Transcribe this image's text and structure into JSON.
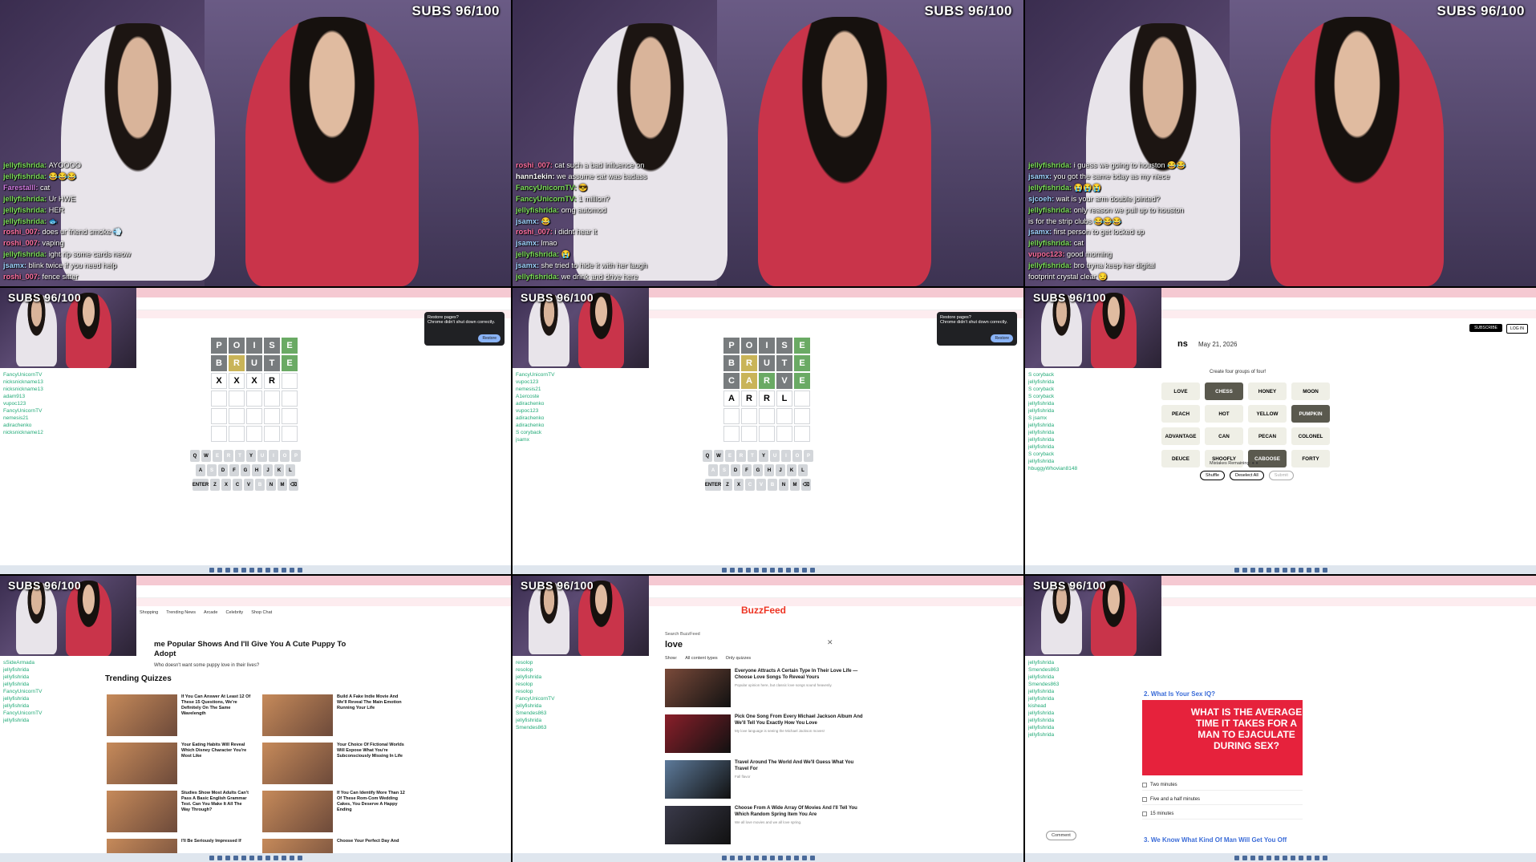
{
  "subs_badge": "SUBS 96/100",
  "stream1": {
    "chat": [
      {
        "user": "jellyfishrida",
        "color": "#7ddf5a",
        "msg": "AYOOOO"
      },
      {
        "user": "jellyfishrida",
        "color": "#7ddf5a",
        "msg": "😂😂😂"
      },
      {
        "user": "Farestalll",
        "color": "#d07ae0",
        "msg": "cat"
      },
      {
        "user": "jellyfishrida",
        "color": "#7ddf5a",
        "msg": "Ur HWE"
      },
      {
        "user": "jellyfishrida",
        "color": "#7ddf5a",
        "msg": "HER"
      },
      {
        "user": "jellyfishrida",
        "color": "#7ddf5a",
        "msg": "🐟"
      },
      {
        "user": "roshi_007",
        "color": "#ff6fa0",
        "msg": "does ur friend smoke 💨"
      },
      {
        "user": "roshi_007",
        "color": "#ff6fa0",
        "msg": "vaping"
      },
      {
        "user": "jellyfishrida",
        "color": "#7ddf5a",
        "msg": "ight rip some cards neow"
      },
      {
        "user": "jsamx",
        "color": "#9fd4ff",
        "msg": "blink twice if you need help"
      },
      {
        "user": "roshi_007",
        "color": "#ff6fa0",
        "msg": "fence sitter"
      }
    ]
  },
  "stream2": {
    "chat": [
      {
        "user": "roshi_007",
        "color": "#ff6fa0",
        "msg": "cat such a bad influence on"
      },
      {
        "user": "hann1ekin",
        "color": "#ffffff",
        "msg": "we assume cat was badass"
      },
      {
        "user": "FancyUnicornTV",
        "color": "#7ddf5a",
        "msg": "😎"
      },
      {
        "user": "FancyUnicornTV",
        "color": "#7ddf5a",
        "msg": "1 million?"
      },
      {
        "user": "jellyfishrida",
        "color": "#7ddf5a",
        "msg": "omg automod"
      },
      {
        "user": "jsamx",
        "color": "#9fd4ff",
        "msg": "😂"
      },
      {
        "user": "roshi_007",
        "color": "#ff6fa0",
        "msg": "i didnt hear it"
      },
      {
        "user": "jsamx",
        "color": "#9fd4ff",
        "msg": "lmao"
      },
      {
        "user": "jellyfishrida",
        "color": "#7ddf5a",
        "msg": "😭"
      },
      {
        "user": "jsamx",
        "color": "#9fd4ff",
        "msg": "she tried to hide it with her laugh"
      },
      {
        "user": "jellyfishrida",
        "color": "#7ddf5a",
        "msg": "we drink and drive here"
      }
    ]
  },
  "stream3": {
    "chat": [
      {
        "user": "jellyfishrida",
        "color": "#7ddf5a",
        "msg": "i guess we going to houston 😂😂"
      },
      {
        "user": "jsamx",
        "color": "#9fd4ff",
        "msg": "you got the same bday as my niece"
      },
      {
        "user": "jellyfishrida",
        "color": "#7ddf5a",
        "msg": "😭😭😭"
      },
      {
        "user": "sjcoeh",
        "color": "#9fd4ff",
        "msg": "wait is your arm double jointed?"
      },
      {
        "user": "jellyfishrida",
        "color": "#7ddf5a",
        "msg": "only reason we pull up to houston"
      },
      {
        "user": "",
        "color": "#ffffff",
        "msg": "is for the strip clubs 😂😂😂"
      },
      {
        "user": "jsamx",
        "color": "#9fd4ff",
        "msg": "first person to get locked up"
      },
      {
        "user": "jellyfishrida",
        "color": "#7ddf5a",
        "msg": "cat"
      },
      {
        "user": "vupoc123",
        "color": "#ff6fa0",
        "msg": "good morning"
      },
      {
        "user": "jellyfishrida",
        "color": "#7ddf5a",
        "msg": "bro tryna keep her digital"
      },
      {
        "user": "",
        "color": "#ffffff",
        "msg": "footprint crystal clear 😏"
      }
    ]
  },
  "wordle1": {
    "rows": [
      [
        {
          "l": "P",
          "s": "x"
        },
        {
          "l": "O",
          "s": "x"
        },
        {
          "l": "I",
          "s": "x"
        },
        {
          "l": "S",
          "s": "x"
        },
        {
          "l": "E",
          "s": "g"
        }
      ],
      [
        {
          "l": "B",
          "s": "x"
        },
        {
          "l": "R",
          "s": "y"
        },
        {
          "l": "U",
          "s": "x"
        },
        {
          "l": "T",
          "s": "x"
        },
        {
          "l": "E",
          "s": "g"
        }
      ],
      [
        {
          "l": "X",
          "s": "e"
        },
        {
          "l": "X",
          "s": "e"
        },
        {
          "l": "X",
          "s": "e"
        },
        {
          "l": "R",
          "s": "e"
        },
        {
          "l": "",
          "s": "e"
        }
      ]
    ],
    "popup_title": "Restore pages?",
    "popup_body": "Chrome didn't shut down correctly.",
    "popup_btn": "Restore",
    "chat": [
      "FancyUnicornTV",
      "nicksnickname13",
      "nicksnickname13",
      "adam913",
      "vupoc123",
      "FancyUnicornTV",
      "nemesis21",
      "adirachenko",
      "nicksnickname12"
    ]
  },
  "wordle2": {
    "rows": [
      [
        {
          "l": "P",
          "s": "x"
        },
        {
          "l": "O",
          "s": "x"
        },
        {
          "l": "I",
          "s": "x"
        },
        {
          "l": "S",
          "s": "x"
        },
        {
          "l": "E",
          "s": "g"
        }
      ],
      [
        {
          "l": "B",
          "s": "x"
        },
        {
          "l": "R",
          "s": "y"
        },
        {
          "l": "U",
          "s": "x"
        },
        {
          "l": "T",
          "s": "x"
        },
        {
          "l": "E",
          "s": "g"
        }
      ],
      [
        {
          "l": "C",
          "s": "x"
        },
        {
          "l": "A",
          "s": "y"
        },
        {
          "l": "R",
          "s": "g"
        },
        {
          "l": "V",
          "s": "x"
        },
        {
          "l": "E",
          "s": "g"
        }
      ],
      [
        {
          "l": "A",
          "s": "e"
        },
        {
          "l": "R",
          "s": "e"
        },
        {
          "l": "R",
          "s": "e"
        },
        {
          "l": "L",
          "s": "e"
        },
        {
          "l": "",
          "s": "e"
        }
      ]
    ],
    "popup_title": "Restore pages?",
    "popup_body": "Chrome didn't shut down correctly.",
    "popup_btn": "Restore",
    "chat": [
      "FancyUnicornTV",
      "vupoc123",
      "nemesis21",
      "A1ercoste",
      "adirachenko",
      "vupoc123",
      "adirachenko",
      "adirachenko",
      "S coryback",
      "jsamx"
    ]
  },
  "keyboard": [
    [
      "Q",
      "W",
      "E",
      "R",
      "T",
      "Y",
      "U",
      "I",
      "O",
      "P"
    ],
    [
      "A",
      "S",
      "D",
      "F",
      "G",
      "H",
      "J",
      "K",
      "L"
    ],
    [
      "ENTER",
      "Z",
      "X",
      "C",
      "V",
      "B",
      "N",
      "M",
      "⌫"
    ]
  ],
  "connections": {
    "title": "ns",
    "date": "May 21, 2026",
    "subtitle": "Create four groups of four!",
    "words": [
      {
        "w": "LOVE",
        "sel": false
      },
      {
        "w": "CHESS",
        "sel": true
      },
      {
        "w": "HONEY",
        "sel": false
      },
      {
        "w": "MOON",
        "sel": false
      },
      {
        "w": "PEACH",
        "sel": false
      },
      {
        "w": "HOT",
        "sel": false
      },
      {
        "w": "YELLOW",
        "sel": false
      },
      {
        "w": "PUMPKIN",
        "sel": true
      },
      {
        "w": "ADVANTAGE",
        "sel": false
      },
      {
        "w": "CAN",
        "sel": false
      },
      {
        "w": "PECAN",
        "sel": false
      },
      {
        "w": "COLONEL",
        "sel": false
      },
      {
        "w": "DEUCE",
        "sel": false
      },
      {
        "w": "SHOOFLY",
        "sel": false
      },
      {
        "w": "CABOOSE",
        "sel": true
      },
      {
        "w": "FORTY",
        "sel": false
      }
    ],
    "mistakes": "Mistakes Remaining: ● ●",
    "buttons": [
      "Shuffle",
      "Deselect All",
      "Submit"
    ],
    "subscribe": "SUBSCRIBE",
    "login": "LOG IN",
    "chat": [
      "S coryback",
      "jellyfishrida",
      "S coryback",
      "S coryback",
      "jellyfishrida",
      "jellyfishrida",
      "S jsamx",
      "jellyfishrida",
      "jellyfishrida",
      "jellyfishrida",
      "jellyfishrida",
      "S coryback",
      "jellyfishrida",
      "hbuggyWhovian8148"
    ]
  },
  "buzzfeed1": {
    "nav": [
      "Shopping",
      "Trending News",
      "Arcade",
      "Celebrity",
      "Shop Chat"
    ],
    "headline": "me Popular Shows And I'll Give You A Cute Puppy To Adopt",
    "sub": "Who doesn't want some puppy love in their lives?",
    "trending": "Trending Quizzes",
    "quizzes": [
      "If You Can Answer At Least 12 Of These 15 Questions, We're Definitely On The Same Wavelength",
      "Build A Fake Indie Movie And We'll Reveal The Main Emotion Running Your Life",
      "Your Eating Habits Will Reveal Which Disney Character You're Most Like",
      "Your Choice Of Fictional Worlds Will Expose What You're Subconsciously Missing In Life",
      "Studies Show Most Adults Can't Pass A Basic English Grammar Test. Can You Make It All The Way Through?",
      "If You Can Identify More Than 12 Of These Rom-Com Wedding Cakes, You Deserve A Happy Ending",
      "I'll Be Seriously Impressed If",
      "Choose Your Perfect Day And"
    ],
    "chat": [
      "sSideArmada",
      "jellyfishrida",
      "jellyfishrida",
      "jellyfishrida",
      "FancyUnicornTV",
      "jellyfishrida",
      "jellyfishrida",
      "FancyUnicornTV",
      "jellyfishrida"
    ]
  },
  "buzzfeed2": {
    "logo": "BuzzFeed",
    "search_label": "Search BuzzFeed",
    "query": "love",
    "close": "✕",
    "show_label": "Show:",
    "filters": [
      "All content types",
      "Only quizzes"
    ],
    "results": [
      {
        "t": "Everyone Attracts A Certain Type In Their Love Life — Choose Love Songs To Reveal Yours",
        "s": "Popular opinion here, but classic love songs sound heavenly."
      },
      {
        "t": "Pick One Song From Every Michael Jackson Album And We'll Tell You Exactly How You Love",
        "s": "My love language is seeing the Michael Jackson moves!"
      },
      {
        "t": "Travel Around The World And We'll Guess What You Travel For",
        "s": "Fall flavor"
      },
      {
        "t": "Choose From A Wide Array Of Movies And I'll Tell You Which Random Spring Item You Are",
        "s": "We all love movies and we all love spring."
      }
    ],
    "chat": [
      "resolop",
      "resolop",
      "jellyfishrida",
      "resolop",
      "resolop",
      "FancyUnicornTV",
      "jellyfishrida",
      "Smendes863",
      "jellyfishrida",
      "Smendes863"
    ]
  },
  "buzzfeed3": {
    "q2": "2. What Is Your Sex IQ?",
    "q2img": "WHAT IS THE AVERAGE TIME IT TAKES FOR A MAN TO EJACULATE DURING SEX?",
    "options": [
      "Two minutes",
      "Five and a half minutes",
      "15 minutes"
    ],
    "q3": "3. We Know What Kind Of Man Will Get You Off",
    "comment": "Comment",
    "chat": [
      "jellyfishrida",
      "Smendes863",
      "jellyfishrida",
      "Smendes863",
      "jellyfishrida",
      "jellyfishrida",
      "kishead",
      "jellyfishrida",
      "jellyfishrida",
      "jellyfishrida",
      "jellyfishrida"
    ]
  }
}
